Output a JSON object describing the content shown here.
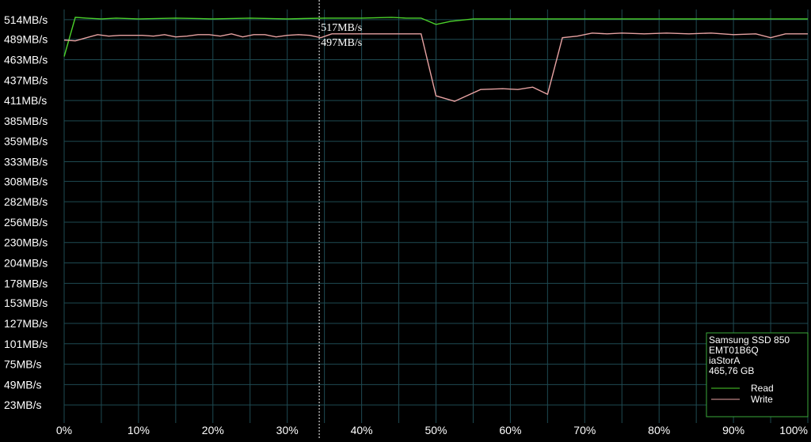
{
  "colors": {
    "background": "#000000",
    "grid": "#1e4a52",
    "read": "#4bd12a",
    "write": "#e7a2a2",
    "legend_border": "#3aa83a",
    "cursor": "#ffffff"
  },
  "cursor": {
    "x": 34.3,
    "read_label": "517MB/s",
    "write_label": "497MB/s"
  },
  "legend": {
    "lines": [
      "Samsung SSD 850",
      "EMT01B6Q",
      "iaStorA",
      "465,76 GB"
    ],
    "read_label": "Read",
    "write_label": "Write"
  },
  "chart_data": {
    "type": "line",
    "title": "",
    "xlabel": "",
    "ylabel": "",
    "xlim": [
      0,
      100
    ],
    "ylim": [
      0,
      527
    ],
    "grid": true,
    "legend_placement": "bottom-right",
    "y_tick_values": [
      514,
      489,
      463,
      437,
      411,
      385,
      359,
      333,
      308,
      282,
      256,
      230,
      204,
      178,
      153,
      127,
      101,
      75,
      49,
      23
    ],
    "y_tick_labels": [
      "514MB/s",
      "489MB/s",
      "463MB/s",
      "437MB/s",
      "411MB/s",
      "385MB/s",
      "359MB/s",
      "333MB/s",
      "308MB/s",
      "282MB/s",
      "256MB/s",
      "230MB/s",
      "204MB/s",
      "178MB/s",
      "153MB/s",
      "127MB/s",
      "101MB/s",
      "75MB/s",
      "49MB/s",
      "23MB/s"
    ],
    "x_tick_values": [
      0,
      10,
      20,
      30,
      40,
      50,
      60,
      70,
      80,
      90,
      100
    ],
    "x_tick_labels": [
      "0%",
      "10%",
      "20%",
      "30%",
      "40%",
      "50%",
      "60%",
      "70%",
      "80%",
      "90%",
      "100%"
    ],
    "series": [
      {
        "name": "Read",
        "x": [
          0,
          1.5,
          3,
          5,
          7,
          10,
          15,
          20,
          25,
          30,
          35,
          40,
          44,
          46,
          48,
          50,
          52,
          55,
          60,
          65,
          70,
          75,
          80,
          85,
          90,
          95,
          100
        ],
        "y": [
          467,
          517,
          516,
          515,
          516,
          515,
          516,
          515,
          516,
          515,
          516,
          516,
          517,
          516,
          516,
          508,
          512,
          515,
          515,
          515,
          515,
          515,
          515,
          515,
          515,
          515,
          515
        ]
      },
      {
        "name": "Write",
        "x": [
          0,
          1.5,
          3,
          4.5,
          6,
          7.5,
          9,
          10.5,
          12,
          13.5,
          15,
          16.5,
          18,
          19.5,
          21,
          22.5,
          24,
          25.5,
          27,
          28.5,
          30,
          31.5,
          33,
          34.5,
          36,
          40,
          44,
          48,
          50,
          52.5,
          56,
          59,
          61,
          63,
          65,
          67,
          69,
          71,
          73,
          75,
          78,
          81,
          84,
          87,
          90,
          93,
          95,
          97,
          100
        ],
        "y": [
          488,
          487,
          491,
          495,
          493,
          494,
          494,
          494,
          493,
          495,
          492,
          493,
          495,
          495,
          493,
          496,
          492,
          495,
          495,
          492,
          494,
          495,
          494,
          491,
          496,
          496,
          496,
          496,
          417,
          410,
          425,
          426,
          425,
          428,
          419,
          491,
          493,
          497,
          496,
          497,
          496,
          497,
          496,
          497,
          495,
          496,
          491,
          496,
          496
        ]
      }
    ]
  }
}
